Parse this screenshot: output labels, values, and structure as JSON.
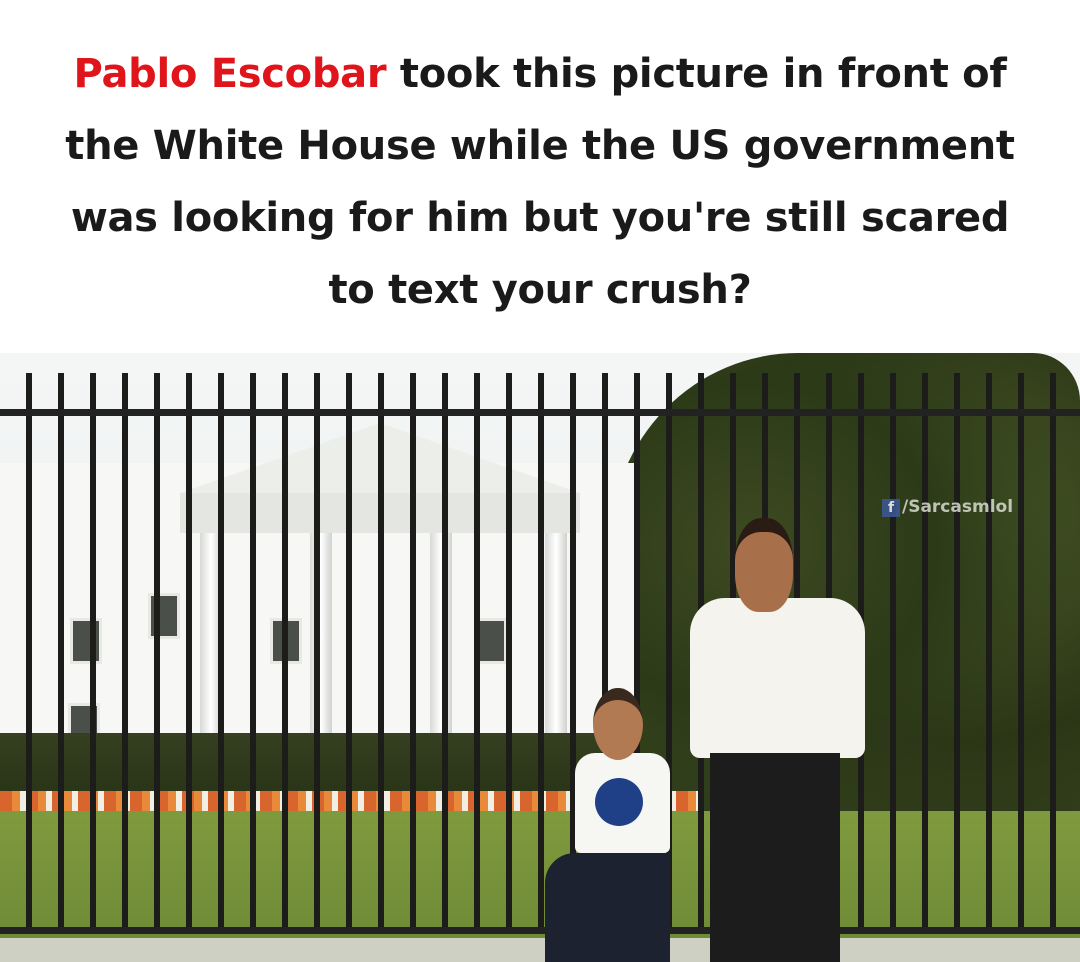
{
  "caption": {
    "highlight": "Pablo Escobar",
    "line1_rest": " took this picture in front of",
    "line2": "the White House while the US government",
    "line3": "was looking for him but you're still scared",
    "line4": "to text your crush?",
    "highlight_color": "#e0141b"
  },
  "photo": {
    "watermark": "/Sarcasmlol",
    "watermark_icon": "facebook-icon",
    "watermark_icon_glyph": "f"
  }
}
